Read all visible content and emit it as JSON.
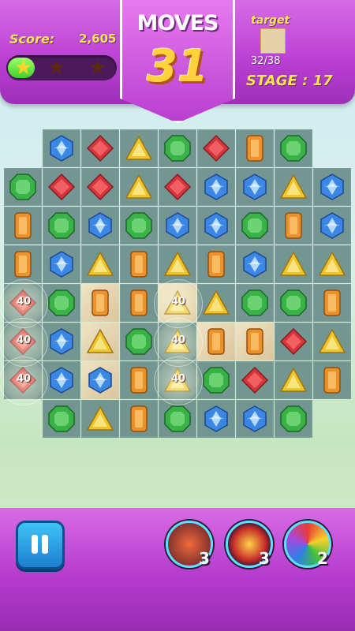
{
  "hud": {
    "score_label": "Score:",
    "score_value": "2,605",
    "stars_earned": 1,
    "stars_total": 3,
    "progress": 0.25,
    "moves_label": "MOVES",
    "moves_value": "31",
    "target_label": "target",
    "target_count": "32/38",
    "stage_label": "STAGE : 17"
  },
  "board": {
    "rows": [
      [
        "",
        "blue",
        "red",
        "yellow",
        "green",
        "red",
        "orange",
        "green",
        ""
      ],
      [
        "green",
        "red",
        "red",
        "yellow",
        "red",
        "blue",
        "blue",
        "yellow",
        "blue"
      ],
      [
        "orange",
        "green",
        "blue",
        "green",
        "blue",
        "blue",
        "green",
        "orange",
        "blue"
      ],
      [
        "orange",
        "blue",
        "yellow",
        "orange",
        "yellow",
        "orange",
        "blue",
        "yellow",
        "yellow"
      ],
      [
        "red",
        "green",
        "orange",
        "orange",
        "yellow",
        "yellow",
        "green",
        "green",
        "orange"
      ],
      [
        "red",
        "blue",
        "yellow",
        "green",
        "yellow",
        "orange",
        "orange",
        "red",
        "yellow"
      ],
      [
        "red",
        "blue",
        "blue",
        "orange",
        "yellow",
        "green",
        "red",
        "yellow",
        "orange"
      ],
      [
        "",
        "green",
        "yellow",
        "orange",
        "green",
        "blue",
        "blue",
        "green",
        ""
      ]
    ],
    "sand_cells": [
      [
        4,
        2
      ],
      [
        5,
        2
      ],
      [
        6,
        2
      ],
      [
        4,
        4
      ],
      [
        5,
        5
      ],
      [
        5,
        6
      ]
    ],
    "pops": [
      {
        "row": 4,
        "col": 0,
        "points": "40"
      },
      {
        "row": 5,
        "col": 0,
        "points": "40"
      },
      {
        "row": 6,
        "col": 0,
        "points": "40"
      },
      {
        "row": 4,
        "col": 4,
        "points": "40"
      },
      {
        "row": 5,
        "col": 4,
        "points": "40"
      },
      {
        "row": 6,
        "col": 4,
        "points": "40"
      }
    ],
    "colors": {
      "blue": "#2f7fe6",
      "red": "#d8262e",
      "yellow": "#f2c21c",
      "green": "#2cae3b",
      "orange": "#ef8a1c"
    }
  },
  "controls": {
    "pause_icon": "pause-icon",
    "boosters": [
      {
        "icon": "bomb-booster-icon",
        "count": "3"
      },
      {
        "icon": "cross-booster-icon",
        "count": "3"
      },
      {
        "icon": "rainbow-star-booster-icon",
        "count": "2"
      }
    ]
  }
}
